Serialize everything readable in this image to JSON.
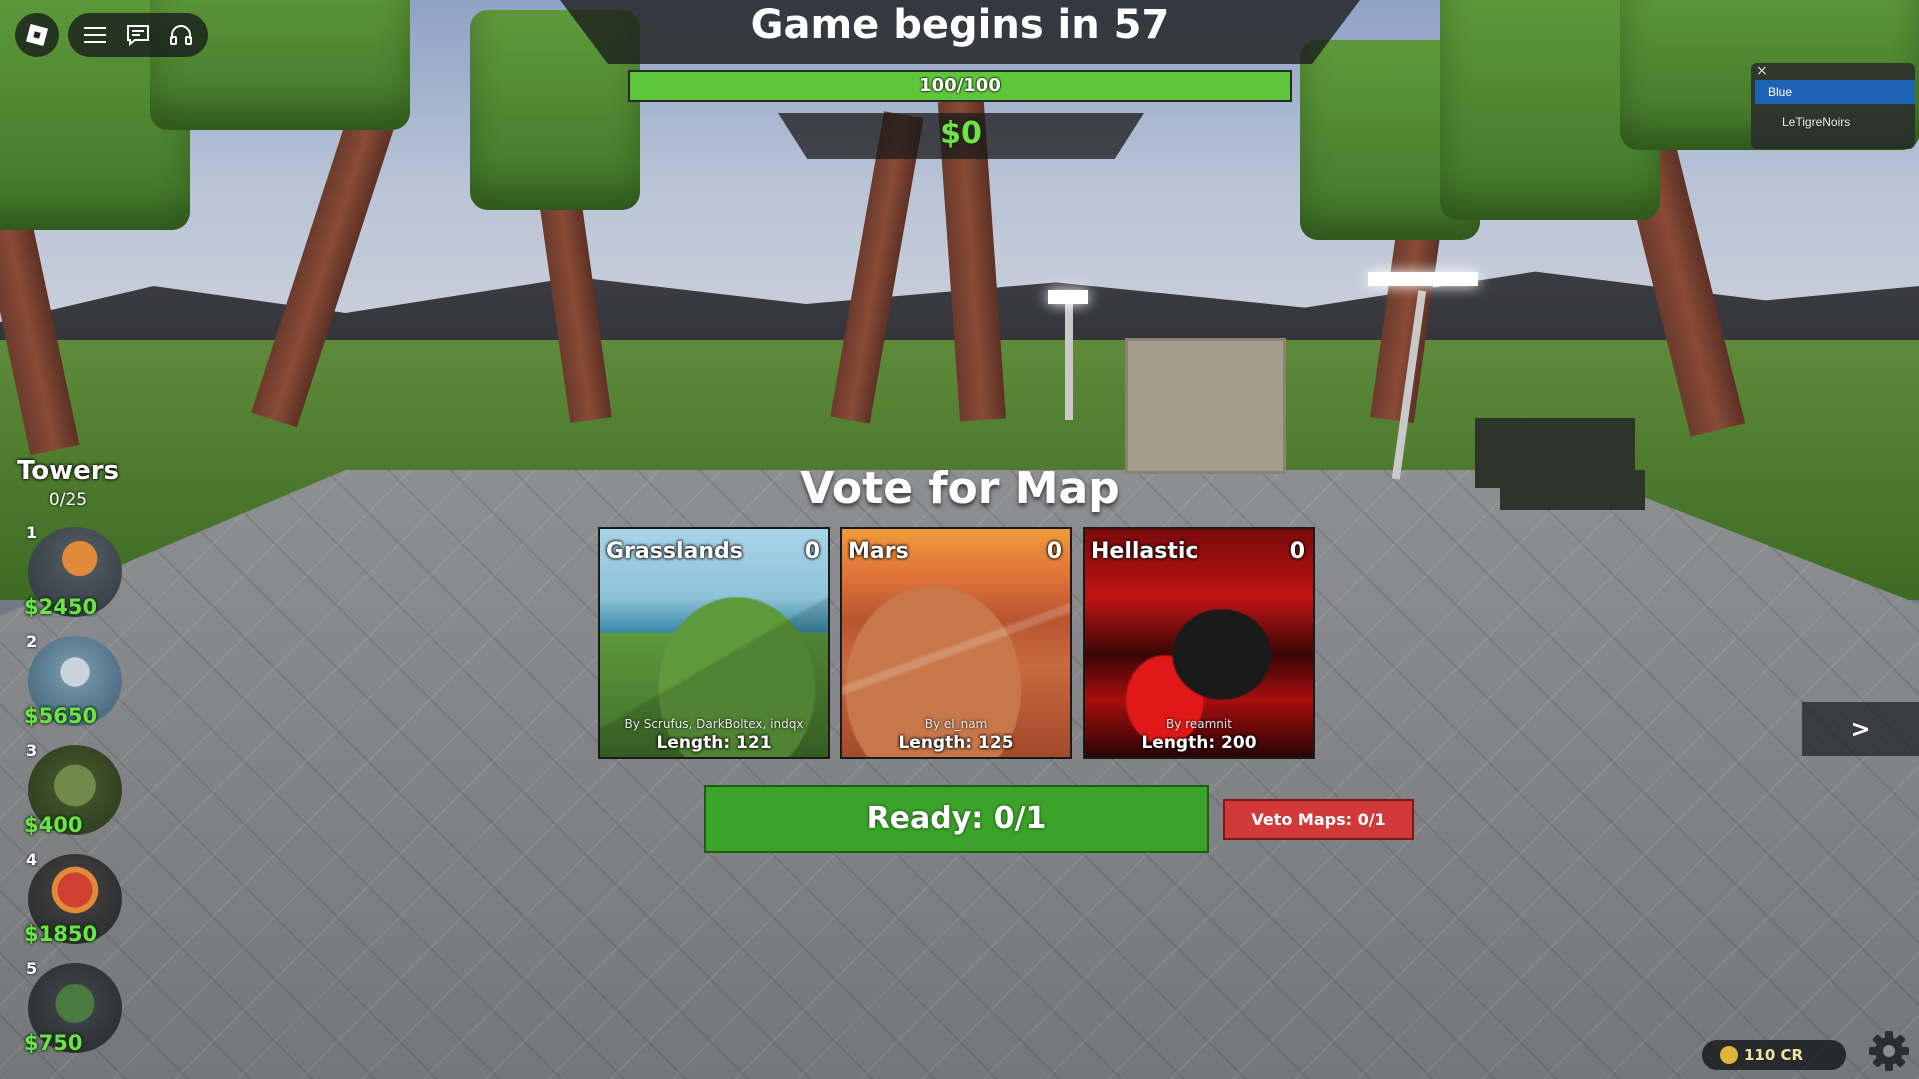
{
  "header": {
    "title": "Game begins in 57",
    "health_text": "100/100",
    "health_fraction": 1.0,
    "cash": "$0"
  },
  "topbar": {
    "roblox_icon": "roblox-logo-icon",
    "menu_icon": "hamburger-menu-icon",
    "chat_icon": "chat-icon",
    "voice_icon": "headphones-icon"
  },
  "team_panel": {
    "close_glyph": "×",
    "team_name": "Blue",
    "players": [
      "LeTigreNoirs"
    ]
  },
  "towers": {
    "title": "Towers",
    "count": "0/25",
    "slots": [
      {
        "num": "1",
        "price": "$2450"
      },
      {
        "num": "2",
        "price": "$5650"
      },
      {
        "num": "3",
        "price": "$400"
      },
      {
        "num": "4",
        "price": "$1850"
      },
      {
        "num": "5",
        "price": "$750"
      }
    ]
  },
  "vote": {
    "title": "Vote for Map",
    "maps": [
      {
        "name": "Grasslands",
        "votes": "0",
        "author": "By Scrufus, DarkBoltex, indqx",
        "length": "Length: 121"
      },
      {
        "name": "Mars",
        "votes": "0",
        "author": "By el_nam",
        "length": "Length: 125"
      },
      {
        "name": "Hellastic",
        "votes": "0",
        "author": "By reamnit",
        "length": "Length: 200"
      }
    ],
    "ready_label": "Ready: 0/1",
    "veto_label": "Veto Maps: 0/1"
  },
  "next_label": ">",
  "credits": "110 CR",
  "settings_icon": "gear-icon",
  "colors": {
    "health_green": "#5ec63a",
    "cash_green": "#6ee24a",
    "ready_green": "#3ba22a",
    "veto_red": "#d23a3a",
    "team_blue": "#1f63b4"
  }
}
